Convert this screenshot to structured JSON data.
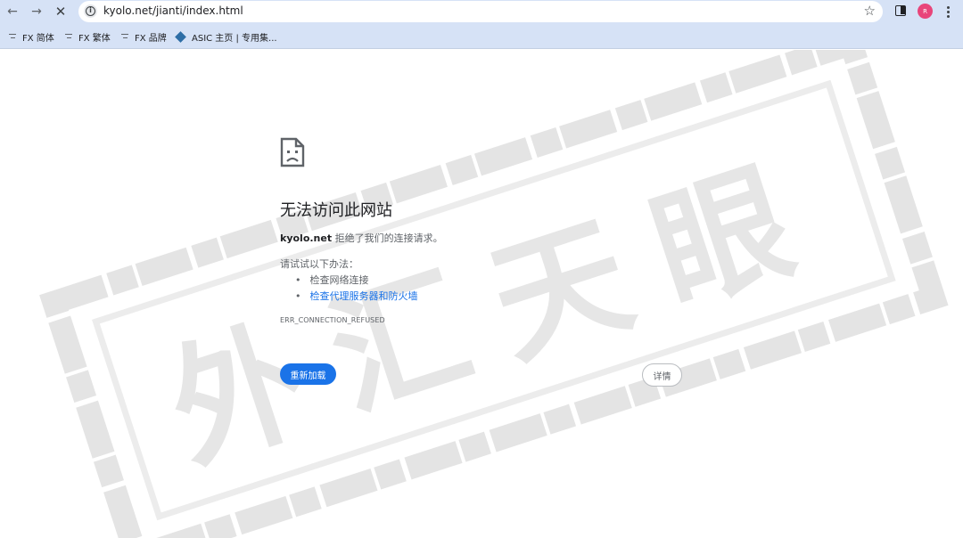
{
  "browser": {
    "url": "kyolo.net/jianti/index.html",
    "nav": {
      "back_icon": "arrow-left-icon",
      "forward_icon": "arrow-right-icon",
      "stop_icon": "close-icon"
    },
    "avatar_text": "R",
    "bookmarks": [
      {
        "label": "FX 简体",
        "icon": "fx-icon"
      },
      {
        "label": "FX 繁体",
        "icon": "fx-icon"
      },
      {
        "label": "FX 品牌",
        "icon": "fx-icon"
      },
      {
        "label": "ASIC 主页 | 专用集...",
        "icon": "diamond-icon"
      }
    ]
  },
  "error_page": {
    "title": "无法访问此网站",
    "host": "kyolo.net",
    "message": " 拒绝了我们的连接请求。",
    "try_label": "请试试以下办法：",
    "suggestions": [
      {
        "text": "检查网络连接",
        "is_link": false
      },
      {
        "text": "检查代理服务器和防火墙",
        "is_link": true
      }
    ],
    "error_code": "ERR_CONNECTION_REFUSED",
    "reload_label": "重新加载",
    "details_label": "详情"
  },
  "watermark": {
    "text": "外汇天眼"
  },
  "colors": {
    "chrome_bg": "#d6e2f6",
    "accent": "#1a73e8",
    "watermark": "#e2e2e2"
  }
}
